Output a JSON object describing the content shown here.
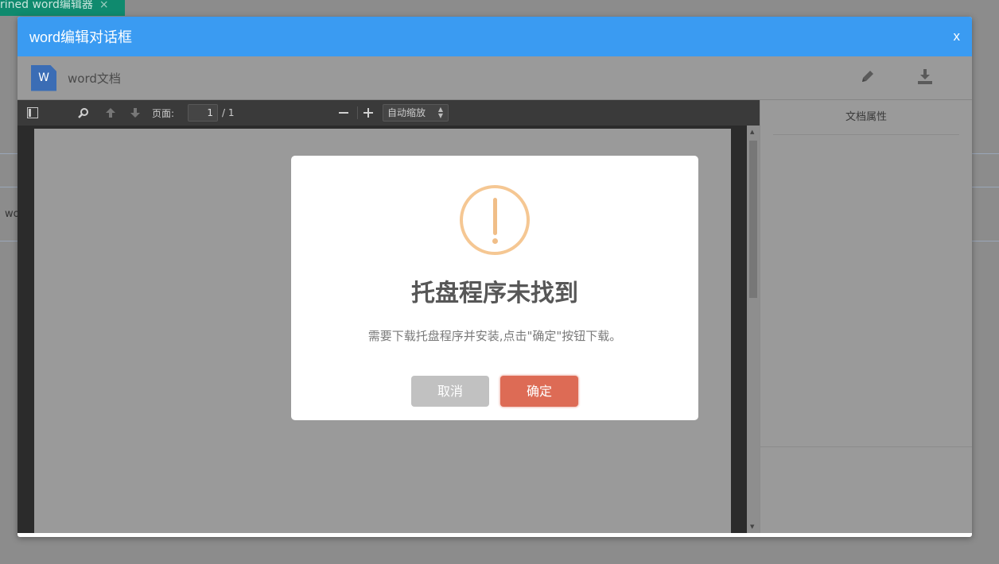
{
  "background": {
    "tab_label": "rined word编辑器",
    "tab_close": "×",
    "cell_text": "wo"
  },
  "dialog": {
    "title": "word编辑对话框",
    "close_label": "x"
  },
  "document": {
    "icon_letter": "W",
    "name": "word文档",
    "actions": [
      "pencil-icon",
      "download-icon"
    ]
  },
  "viewer": {
    "page_label": "页面:",
    "page_current": "1",
    "page_total": "/ 1",
    "zoom_value": "自动缩放"
  },
  "properties": {
    "title": "文档属性"
  },
  "alert": {
    "title": "托盘程序未找到",
    "message": "需要下载托盘程序并安装,点击\"确定\"按钮下载。",
    "cancel_label": "取消",
    "confirm_label": "确定",
    "icon": "warning-icon",
    "colors": {
      "confirm": "#dd6b55",
      "cancel": "#c1c1c1",
      "warning": "#f5c793",
      "header": "#3a9bf2"
    }
  }
}
